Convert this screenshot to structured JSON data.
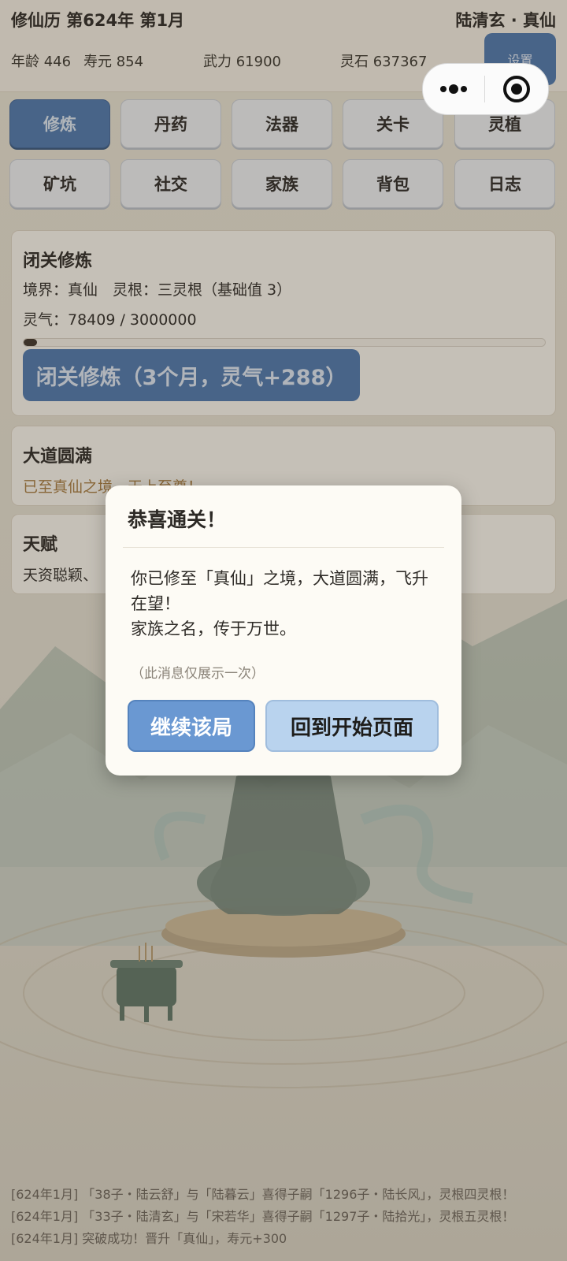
{
  "header": {
    "calendar": "修仙历 第624年 第1月",
    "player": "陆清玄 · 真仙",
    "age": "年龄 446",
    "lifespan": "寿元 854",
    "power": "武力 61900",
    "spirit_stones": "灵石 637367",
    "settings_label": "设置"
  },
  "nav": {
    "row1": [
      "修炼",
      "丹药",
      "法器",
      "关卡",
      "灵植"
    ],
    "row2": [
      "矿坑",
      "社交",
      "家族",
      "背包",
      "日志"
    ],
    "active": "修炼"
  },
  "cultivation": {
    "title": "闭关修炼",
    "realm_line": "境界：真仙　灵根：三灵根（基础值 3）",
    "qi_line": "灵气：78409 / 3000000",
    "qi_progress": 0.026,
    "button_label": "闭关修炼（3个月，灵气+288）"
  },
  "dao": {
    "title": "大道圆满",
    "text": "已至真仙之境，天上至尊！"
  },
  "talent": {
    "title": "天赋",
    "text": "天资聪颖、"
  },
  "modal": {
    "title": "恭喜通关！",
    "body_line1": "你已修至「真仙」之境，大道圆满，飞升在望！",
    "body_line2": "家族之名，传于万世。",
    "note": "（此消息仅展示一次）",
    "continue_label": "继续该局",
    "home_label": "回到开始页面"
  },
  "log": [
    "[624年1月] 「38子・陆云舒」与「陆暮云」喜得子嗣「1296子・陆长风」，灵根四灵根！",
    "[624年1月] 「33子・陆清玄」与「宋若华」喜得子嗣「1297子・陆拾光」，灵根五灵根！",
    "[624年1月] 突破成功！晋升「真仙」，寿元+300"
  ],
  "colors": {
    "accent": "#4d78ad",
    "continue": "#6a98d2",
    "home": "#b9d3ee"
  }
}
